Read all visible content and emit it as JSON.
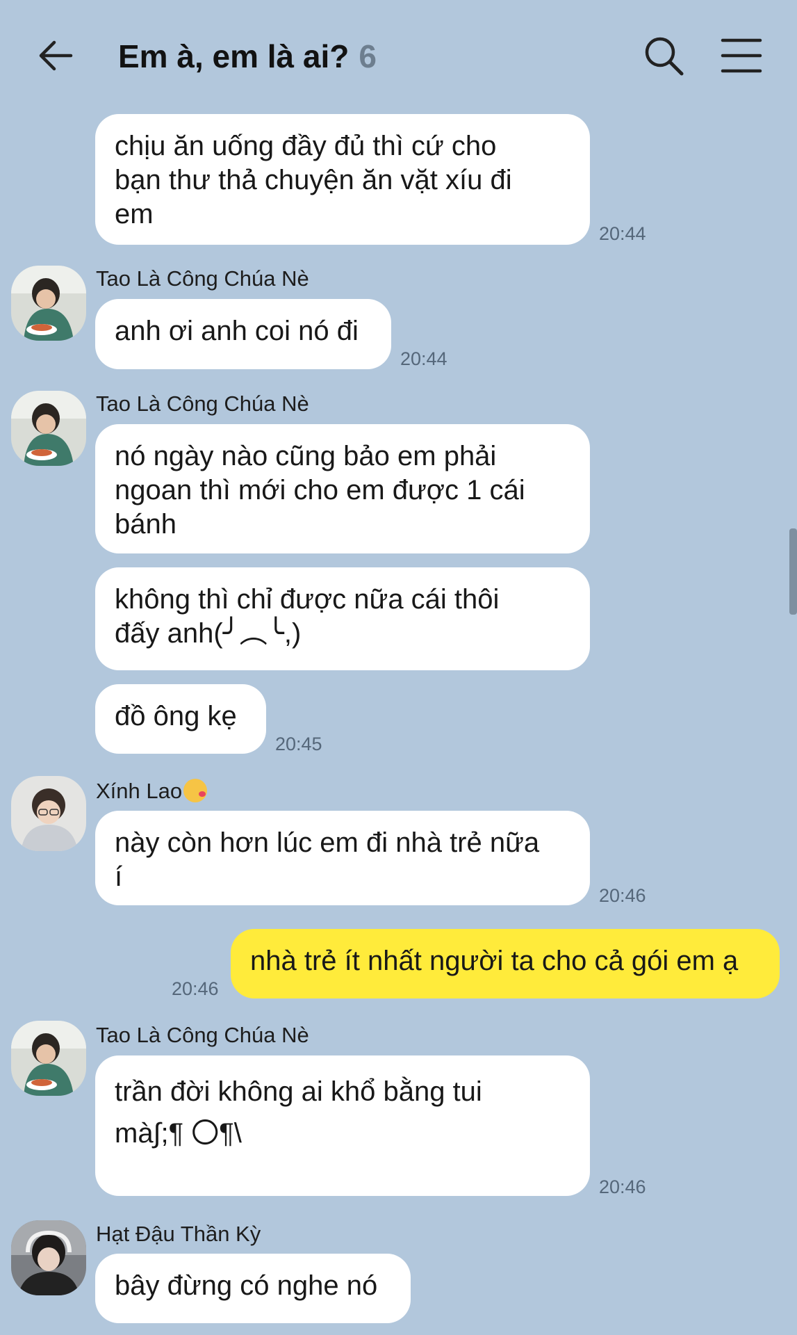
{
  "header": {
    "title": "Em à, em là ai?",
    "member_count": "6",
    "back_icon": "arrow-left-icon",
    "search_icon": "search-icon",
    "menu_icon": "hamburger-menu-icon"
  },
  "messages": [
    {
      "text": "chịu ăn uống đầy đủ thì cứ cho\nbạn thư thả chuyện ăn vặt xíu đi\nem",
      "time": "20:44"
    },
    {
      "sender": "Tao Là Công Chúa Nè",
      "text": "anh ơi anh coi nó đi",
      "time": "20:44"
    },
    {
      "sender": "Tao Là Công Chúa Nè",
      "text": "nó ngày nào cũng bảo em phải\nngoan thì mới cho em được 1 cái\nbánh"
    },
    {
      "text": "không thì chỉ được nữa cái thôi\nđấy anh(╯︵╰,)"
    },
    {
      "text": "đồ ông kẹ",
      "time": "20:45"
    },
    {
      "sender": "Xính Lao",
      "sender_emoji": "kissing-face-emoji",
      "text": "này còn hơn lúc em đi nhà trẻ nữa\ní",
      "time": "20:46"
    },
    {
      "text": "nhà trẻ ít nhất người ta cho cả gói em ạ",
      "time": "20:46",
      "mine": true
    },
    {
      "sender": "Tao Là Công Chúa Nè",
      "text": "trần đời không ai khổ bằng tui\nmà∫;¶ 〇¶\\",
      "time": "20:46"
    },
    {
      "sender": "Hạt Đậu Thần Kỳ",
      "text": "bây đừng có nghe nó"
    }
  ],
  "colors": {
    "background": "#b2c7dc",
    "bubble_other": "#ffffff",
    "bubble_mine": "#ffeb3b",
    "timestamp": "#55677a"
  }
}
